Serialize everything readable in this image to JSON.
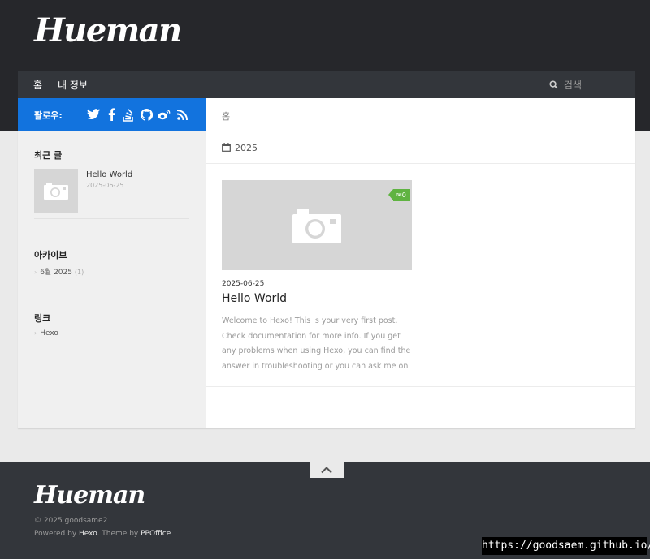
{
  "header": {
    "logo": "Hueman"
  },
  "nav": {
    "items": [
      {
        "label": "홈"
      },
      {
        "label": "내 정보"
      }
    ],
    "search_placeholder": "검색"
  },
  "sidebar": {
    "follow_label": "팔로우:",
    "social_icons": [
      "twitter-icon",
      "facebook-icon",
      "stackoverflow-icon",
      "github-icon",
      "weibo-icon",
      "rss-icon"
    ],
    "recent": {
      "title": "최근 글",
      "post_title": "Hello World",
      "post_date": "2025-06-25"
    },
    "archive": {
      "title": "아카이브",
      "item": "6월 2025",
      "count": "(1)"
    },
    "links": {
      "title": "링크",
      "item": "Hexo"
    }
  },
  "main": {
    "breadcrumb": "홈",
    "archive_year": "2025",
    "post": {
      "comments": "0",
      "date": "2025-06-25",
      "title": "Hello World",
      "excerpt": "Welcome to Hexo! This is your very first post. Check documentation for more info. If you get any problems when using Hexo, you can find the answer in troubleshooting or you can ask me on"
    }
  },
  "footer": {
    "logo": "Hueman",
    "copyright": "© 2025 goodsame2",
    "powered_prefix": "Powered by ",
    "powered_link": "Hexo",
    "theme_prefix": ". Theme by ",
    "theme_link": "PPOffice"
  },
  "overlay_url": "https://goodsaem.github.io/",
  "colors": {
    "accent_blue": "#1273de",
    "comment_green": "#5fb341",
    "dark_bg": "#26272b"
  }
}
